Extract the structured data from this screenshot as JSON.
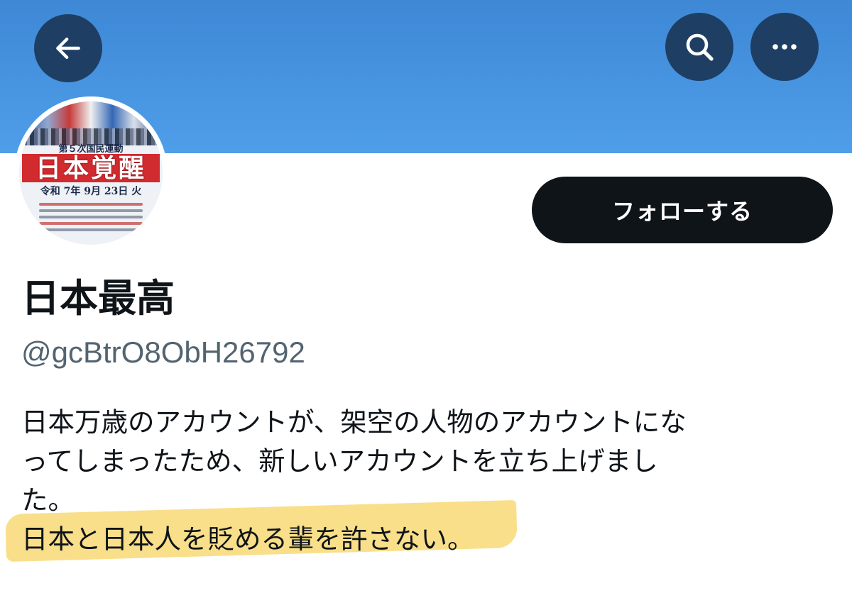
{
  "header": {
    "back_icon": "arrow-left-icon",
    "search_icon": "search-icon",
    "more_icon": "more-horizontal-icon",
    "banner_color": "#4a94e2",
    "button_color": "#1e3f63"
  },
  "avatar": {
    "subtitle": "第５次国民運動",
    "title": "日本覚醒",
    "date": "令和 7年 9月 23日 火"
  },
  "profile": {
    "follow_label": "フォローする",
    "display_name": "日本最高",
    "handle": "@gcBtrO8ObH26792",
    "bio_lines": [
      "日本万歳のアカウントが、架空の人物のアカウントにな",
      "ってしまったため、新しいアカウントを立ち上げまし",
      "た。",
      "日本と日本人を貶める輩を許さない。"
    ],
    "highlight_color": "#f7d35c"
  }
}
